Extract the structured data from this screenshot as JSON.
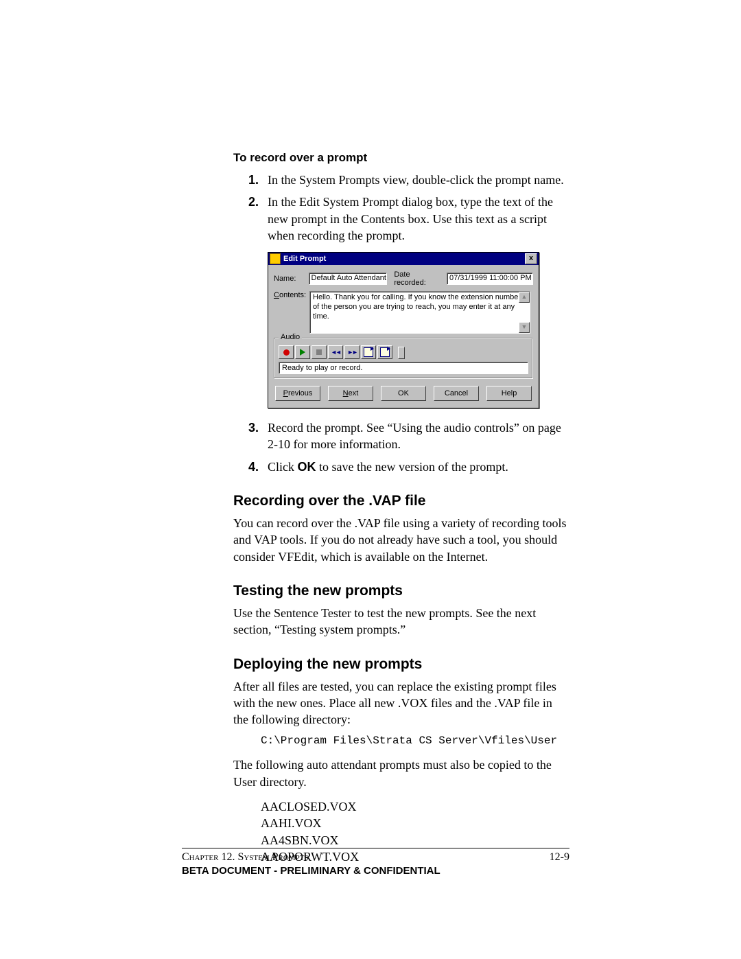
{
  "heading_record_over": "To record over a prompt",
  "steps_a": {
    "n1": "1.",
    "s1": "In the System Prompts view, double-click the prompt name.",
    "n2": "2.",
    "s2": "In the Edit System Prompt dialog box, type the text of the new prompt in the Contents box. Use this text as a script when recording the prompt."
  },
  "dialog": {
    "title": "Edit Prompt",
    "close": "x",
    "name_label": "Name:",
    "name_value": "Default Auto Attendant -",
    "date_label": "Date recorded:",
    "date_value": "07/31/1999 11:00:00 PM",
    "contents_label_pre": "C",
    "contents_label_mid": "ontents:",
    "contents_value": "Hello. Thank you for calling. If you know the extension number of the person you are trying to reach, you may enter it at any time.",
    "scroll_up": "▲",
    "scroll_down": "▼",
    "group_audio": "Audio",
    "rewind": "◄◄",
    "forward": "►►",
    "status": "Ready to play or record.",
    "btn_prev_u": "P",
    "btn_prev_rest": "revious",
    "btn_next_u": "N",
    "btn_next_rest": "ext",
    "btn_ok": "OK",
    "btn_cancel": "Cancel",
    "btn_help": "Help"
  },
  "steps_b": {
    "n3": "3.",
    "s3": "Record the prompt. See “Using the audio controls” on page 2-10 for more information.",
    "n4": "4.",
    "s4_pre": "Click ",
    "s4_bold": "OK",
    "s4_post": " to save the new version of the prompt."
  },
  "sec_vap": {
    "title": "Recording over the .VAP file",
    "body": "You can record over the .VAP file using a variety of recording tools and VAP tools. If you do not already have such a tool, you should consider VFEdit, which is available on the Internet."
  },
  "sec_test": {
    "title": "Testing the new prompts",
    "body": "Use the Sentence Tester to test the new prompts. See the next section, “Testing system prompts.”"
  },
  "sec_deploy": {
    "title": "Deploying the new prompts",
    "body1": "After all files are tested, you can replace the existing prompt files with the new ones. Place all new .VOX files and the .VAP file in the following directory:",
    "code": "C:\\Program Files\\Strata CS Server\\Vfiles\\User",
    "body2": "The following auto attendant prompts must also be copied to the User directory.",
    "files": {
      "f1": "AACLOSED.VOX",
      "f2": "AAHI.VOX",
      "f3": "AA4SBN.VOX",
      "f4": "AAOPORWT.VOX"
    }
  },
  "footer": {
    "chapter": "Chapter 12. System Prompts",
    "pagenum": "12-9",
    "confidential": "Beta Document - Preliminary & Confidential"
  }
}
